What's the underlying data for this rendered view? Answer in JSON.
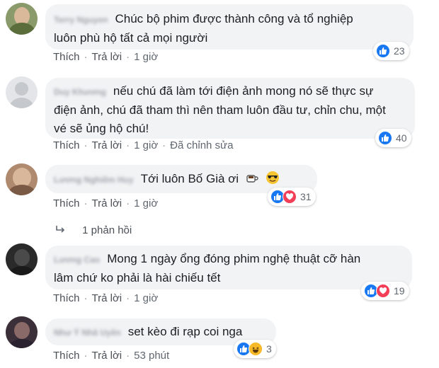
{
  "comments": [
    {
      "author": "Terry Nguyen",
      "text": "Chúc bộ phim được thành công và tổ nghiệp luôn phù hộ tất cả mọi người",
      "line1": "Chúc bộ phim được thành công và tổ nghiệp",
      "line2": "luôn phù hộ tất cả mọi người",
      "like_label": "Thích",
      "reply_label": "Trả lời",
      "time": "1 giờ",
      "reaction_count": "23",
      "reactions": [
        "like-icon"
      ]
    },
    {
      "author": "Duy Khương",
      "line1": "nếu chú đã làm tới điện ảnh mong nó sẽ thực sự",
      "line2": "điện ảnh, chú đã tham thì nên tham luôn đầu tư, chỉn chu, một",
      "line3": "vé sẽ ủng hộ chú!",
      "like_label": "Thích",
      "reply_label": "Trả lời",
      "time": "1 giờ",
      "edited": "Đã chỉnh sửa",
      "reaction_count": "40",
      "reactions": [
        "like-icon"
      ]
    },
    {
      "author": "Lương Nghiêm Huy",
      "line1": "Tới luôn Bố Già ơi",
      "like_label": "Thích",
      "reply_label": "Trả lời",
      "time": "1 giờ",
      "reaction_count": "31",
      "reactions": [
        "like-icon",
        "love-icon"
      ]
    },
    {
      "author": "Lương Cao",
      "line1": "Mong 1 ngày ổng đóng phim nghệ thuật cỡ hàn",
      "line2": "lâm chứ ko phải là hài chiếu tết",
      "like_label": "Thích",
      "reply_label": "Trả lời",
      "time": "1 giờ",
      "reaction_count": "19",
      "reactions": [
        "like-icon",
        "love-icon"
      ]
    },
    {
      "author": "Như Ý Nhã Uyên",
      "line1": "set kèo đi rạp coi nga",
      "like_label": "Thích",
      "reply_label": "Trả lời",
      "time": "53 phút",
      "reaction_count": "3",
      "reactions": [
        "like-icon",
        "haha-icon"
      ]
    }
  ],
  "replies_link": "1 phản hồi",
  "colors": {
    "bubble": "#f2f3f5",
    "like_blue": "#1877f2",
    "love_red": "#f33e58",
    "haha_yellow": "#f7b928",
    "meta_gray": "#606770"
  }
}
